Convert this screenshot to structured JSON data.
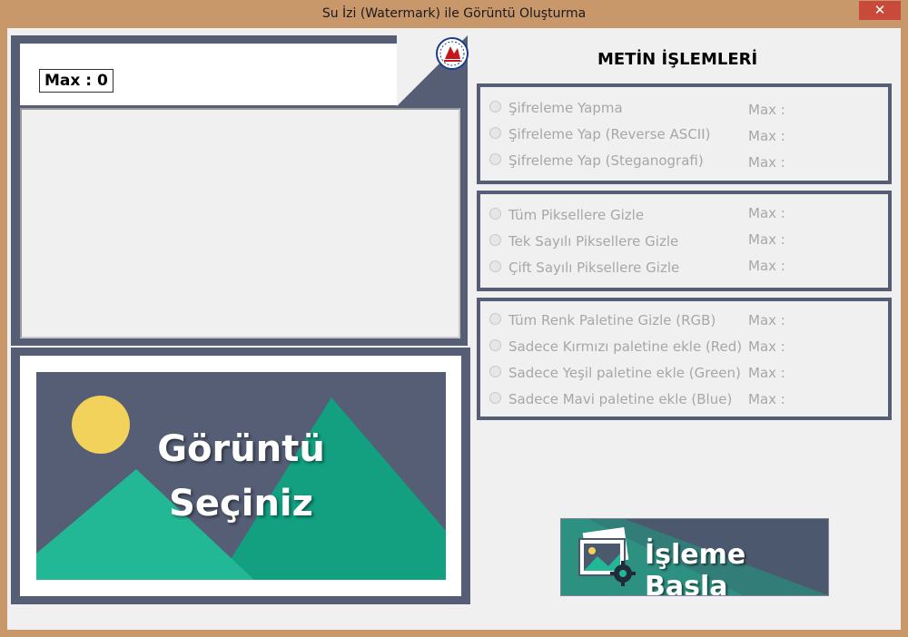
{
  "window": {
    "title": "Su İzi (Watermark) ile Görüntü Oluşturma",
    "close_symbol": "✕"
  },
  "left": {
    "max_label": "Max : 0",
    "image_placeholder": {
      "line1": "Görüntü",
      "line2": "Seçiniz"
    }
  },
  "right": {
    "section_title": "METİN İŞLEMLERİ",
    "groups": [
      {
        "options": [
          {
            "label": "Şifreleme Yapma",
            "max": "Max :"
          },
          {
            "label": "Şifreleme Yap (Reverse ASCII)",
            "max": "Max :"
          },
          {
            "label": "Şifreleme Yap (Steganografi)",
            "max": "Max :"
          }
        ]
      },
      {
        "options": [
          {
            "label": "Tüm Piksellere Gizle",
            "max": "Max :"
          },
          {
            "label": "Tek Sayılı Piksellere Gizle",
            "max": "Max :"
          },
          {
            "label": "Çift Sayılı Piksellere Gizle",
            "max": "Max :"
          }
        ]
      },
      {
        "options": [
          {
            "label": "Tüm Renk Paletine Gizle (RGB)",
            "max": "Max :"
          },
          {
            "label": "Sadece Kırmızı paletine ekle (Red)",
            "max": "Max :"
          },
          {
            "label": "Sadece Yeşil paletine ekle (Green)",
            "max": "Max :"
          },
          {
            "label": "Sadece Mavi paletine ekle (Blue)",
            "max": "Max :"
          }
        ]
      }
    ],
    "start_button": "İşleme Başla"
  },
  "colors": {
    "frame": "#c8976a",
    "panel": "#555e75",
    "accent_green": "#22b896",
    "sun": "#f2d25a"
  },
  "icons": [
    "close-icon",
    "university-logo-icon",
    "image-gallery-icon",
    "gear-icon"
  ]
}
